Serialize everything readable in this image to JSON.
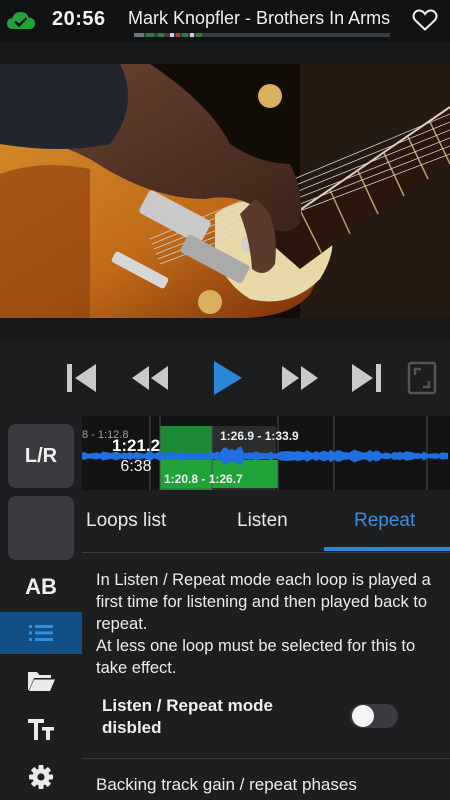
{
  "status": {
    "time": "20:56",
    "song_title": "Mark Knopfler - Brothers In Arms",
    "cloud_icon": "cloud-check-icon",
    "heart_icon": "heart-outline-icon"
  },
  "colors": {
    "accent": "#2d86d6",
    "active_tab": "#3b8fdc",
    "waveform": "#1f6fe0",
    "loop_green": "#22a33a"
  },
  "player": {
    "controls": [
      "skip-previous-icon",
      "rewind-icon",
      "play-icon",
      "fast-forward-icon",
      "skip-next-icon",
      "fullscreen-icon"
    ]
  },
  "waveform": {
    "current_time": "1:21.2",
    "duration": "6:38",
    "loops": [
      {
        "label": "8 - 1:12.8"
      },
      {
        "label": "1:26.9 - 1:33.9"
      },
      {
        "label": "1:20.8 - 1:26.7"
      }
    ]
  },
  "sidebar": {
    "lr_label": "L/R",
    "ab_label": "AB",
    "icons": [
      "list-icon",
      "folder-open-icon",
      "text-size-icon",
      "gear-icon"
    ]
  },
  "tabs": [
    {
      "label": "Loops list"
    },
    {
      "label": "Listen"
    },
    {
      "label": "Repeat"
    }
  ],
  "repeat_panel": {
    "description": "In Listen / Repeat mode each loop is played a first time for listening and then played back to repeat.\nAt less one loop must be selected for this to take effect.",
    "toggle_label": "Listen / Repeat mode disbled",
    "toggle_on": false,
    "backing_label": "Backing track gain / repeat phases"
  }
}
